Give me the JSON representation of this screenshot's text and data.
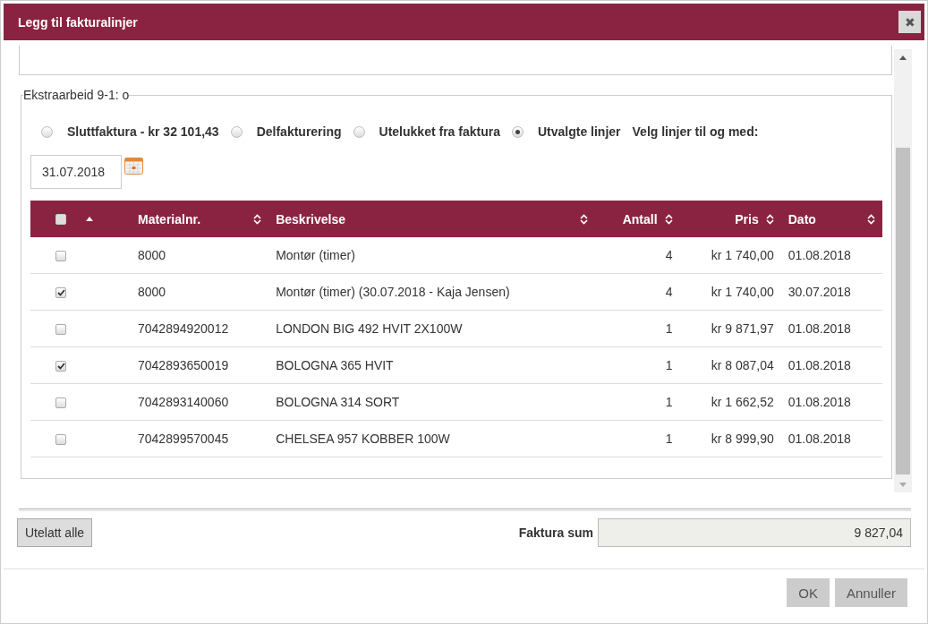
{
  "dialog": {
    "title": "Legg til fakturalinjer",
    "close_label": "✖"
  },
  "section": {
    "legend": "Ekstraarbeid 9-1: o",
    "options": [
      {
        "label": "Sluttfaktura - kr 32 101,43",
        "selected": false
      },
      {
        "label": "Delfakturering",
        "selected": false
      },
      {
        "label": "Utelukket fra faktura",
        "selected": false
      },
      {
        "label": "Utvalgte linjer",
        "selected": true
      }
    ],
    "date_label": "Velg linjer til og med:",
    "date_value": "31.07.2018"
  },
  "table": {
    "select_all_checked": false,
    "columns": [
      {
        "sorted": true
      },
      {
        "label": "Materialnr.",
        "sorted": false
      },
      {
        "label": "Beskrivelse",
        "sorted": false
      },
      {
        "label": "Antall",
        "sorted": false
      },
      {
        "label": "Pris",
        "sorted": false
      },
      {
        "label": "Dato",
        "sorted": false
      }
    ],
    "rows": [
      {
        "checked": false,
        "material": "8000",
        "description": "Montør (timer)",
        "quantity": "4",
        "price": "kr 1 740,00",
        "date": "01.08.2018"
      },
      {
        "checked": true,
        "material": "8000",
        "description": "Montør (timer) (30.07.2018 - Kaja Jensen)",
        "quantity": "4",
        "price": "kr 1 740,00",
        "date": "30.07.2018"
      },
      {
        "checked": false,
        "material": "7042894920012",
        "description": "LONDON BIG 492 HVIT 2X100W",
        "quantity": "1",
        "price": "kr 9 871,97",
        "date": "01.08.2018"
      },
      {
        "checked": true,
        "material": "7042893650019",
        "description": "BOLOGNA 365 HVIT",
        "quantity": "1",
        "price": "kr 8 087,04",
        "date": "01.08.2018"
      },
      {
        "checked": false,
        "material": "7042893140060",
        "description": "BOLOGNA 314 SORT",
        "quantity": "1",
        "price": "kr 1 662,52",
        "date": "01.08.2018"
      },
      {
        "checked": false,
        "material": "7042899570045",
        "description": "CHELSEA 957 KOBBER 100W",
        "quantity": "1",
        "price": "kr 8 999,90",
        "date": "01.08.2018"
      }
    ]
  },
  "footer": {
    "exclude_all_button": "Utelatt alle",
    "sum_label": "Faktura sum",
    "sum_value": "9 827,04"
  },
  "buttons": [
    "OK",
    "Annuller"
  ]
}
